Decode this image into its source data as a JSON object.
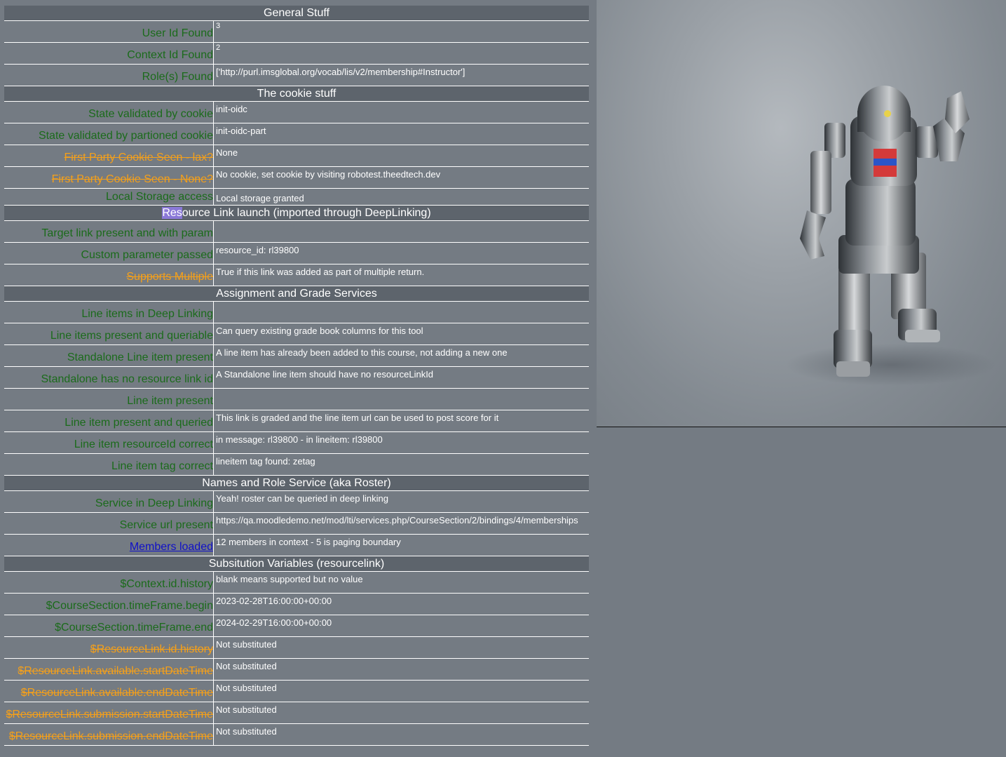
{
  "sections": [
    {
      "title": "General Stuff",
      "rows": [
        {
          "label": "User Id Found",
          "value": "3",
          "status": "ok",
          "sup": true
        },
        {
          "label": "Context Id Found",
          "value": "2",
          "status": "ok",
          "sup": true
        },
        {
          "label": "Role(s) Found",
          "value": "['http://purl.imsglobal.org/vocab/lis/v2/membership#Instructor']",
          "status": "ok"
        }
      ]
    },
    {
      "title": "The cookie stuff",
      "rows": [
        {
          "label": "State validated by cookie",
          "value": "init-oidc",
          "status": "ok"
        },
        {
          "label": "State validated by partioned cookie",
          "value": "init-oidc-part",
          "status": "ok"
        },
        {
          "label": "First Party Cookie Seen - lax?",
          "value": "None",
          "status": "warn"
        },
        {
          "label": "First Party Cookie Seen - None?",
          "value": "No cookie, set cookie by visiting robotest.theedtech.dev",
          "status": "warn"
        },
        {
          "label": "Local Storage access",
          "value": "Local storage granted",
          "status": "ok",
          "short": true
        }
      ]
    },
    {
      "title": "Resource Link launch (imported through DeepLinking)",
      "title_highlight": "Res",
      "title_rest": "ource Link launch (imported through DeepLinking)",
      "rows": [
        {
          "label": "Target link present and with param",
          "value": "",
          "status": "ok"
        },
        {
          "label": "Custom parameter passed",
          "value": "resource_id: rl39800",
          "status": "ok"
        },
        {
          "label": "Supports Multiple",
          "value": "True if this link was added as part of multiple return.",
          "status": "warn"
        }
      ]
    },
    {
      "title": "Assignment and Grade Services",
      "rows": [
        {
          "label": "Line items in Deep Linking",
          "value": "",
          "status": "ok"
        },
        {
          "label": "Line items present and queriable",
          "value": "Can query existing grade book columns for this tool",
          "status": "ok"
        },
        {
          "label": "Standalone Line item present",
          "value": "A line item has already been added to this course, not adding a new one",
          "status": "ok"
        },
        {
          "label": "Standalone has no resource link id",
          "value": "A Standalone line item should have no resourceLinkId",
          "status": "ok"
        },
        {
          "label": "Line item present",
          "value": "",
          "status": "ok"
        },
        {
          "label": "Line item present and queried",
          "value": "This link is graded and the line item url can be used to post score for it",
          "status": "ok"
        },
        {
          "label": "Line item resourceId correct",
          "value": "in message: rl39800 - in lineitem: rl39800",
          "status": "ok"
        },
        {
          "label": "Line item tag correct",
          "value": "lineitem tag found: zetag",
          "status": "ok"
        }
      ]
    },
    {
      "title": "Names and Role Service (aka Roster)",
      "rows": [
        {
          "label": "Service in Deep Linking",
          "value": "Yeah! roster can be queried in deep linking",
          "status": "ok"
        },
        {
          "label": "Service url present",
          "value": "https://qa.moodledemo.net/mod/lti/services.php/CourseSection/2/bindings/4/memberships",
          "status": "ok"
        },
        {
          "label": "Members loaded",
          "value": "12 members in context - 5 is paging boundary",
          "status": "link"
        }
      ]
    },
    {
      "title": "Subsitution Variables (resourcelink)",
      "rows": [
        {
          "label": "$Context.id.history",
          "value": "blank means supported but no value",
          "status": "ok"
        },
        {
          "label": "$CourseSection.timeFrame.begin",
          "value": "2023-02-28T16:00:00+00:00",
          "status": "ok"
        },
        {
          "label": "$CourseSection.timeFrame.end",
          "value": "2024-02-29T16:00:00+00:00",
          "status": "ok"
        },
        {
          "label": "$ResourceLink.id.history",
          "value": "Not substituted",
          "status": "warn"
        },
        {
          "label": "$ResourceLink.available.startDateTime",
          "value": "Not substituted",
          "status": "warn"
        },
        {
          "label": "$ResourceLink.available.endDateTime",
          "value": "Not substituted",
          "status": "warn"
        },
        {
          "label": "$ResourceLink.submission.startDateTime",
          "value": "Not substituted",
          "status": "warn"
        },
        {
          "label": "$ResourceLink.submission.endDateTime",
          "value": "Not substituted",
          "status": "warn"
        }
      ]
    }
  ],
  "colors": {
    "ok": "#1b6b1b",
    "warn": "#f5a01a",
    "link": "#1010c8",
    "header_bg": "#5d646c",
    "page_bg": "#747b83",
    "highlight": "#8a78d8"
  },
  "robot_image": {
    "icon": "robot-icon"
  }
}
